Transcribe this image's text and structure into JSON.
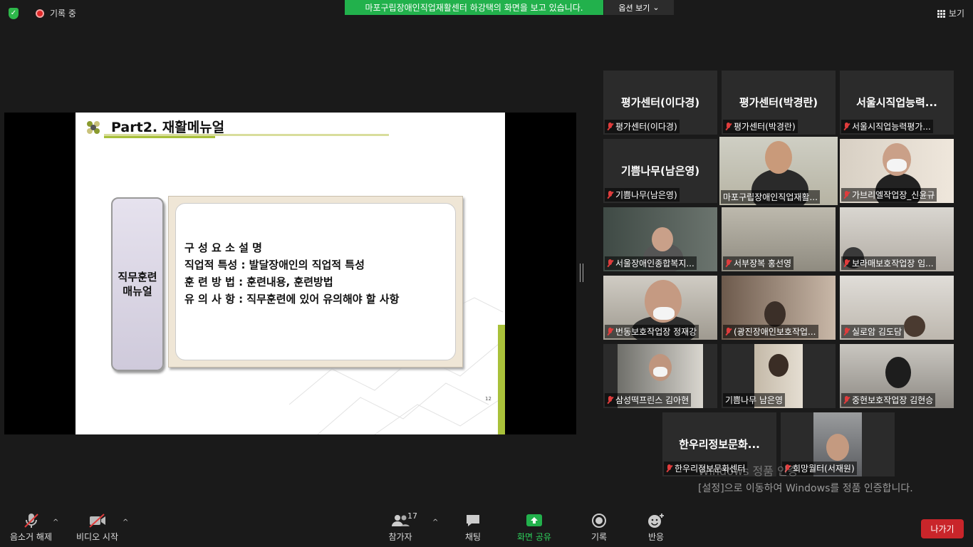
{
  "topbar": {
    "recording_label": "기록 중",
    "share_banner": "마포구립장애인직업재활센터 하강택의 화면을 보고 있습니다.",
    "view_options_label": "옵션 보기",
    "view_label": "보기"
  },
  "slide": {
    "title": "Part2. 재활메뉴얼",
    "side_label_line1": "직무훈련",
    "side_label_line2": "매뉴얼",
    "lines": [
      "구 성  요 소       설  명",
      "직업적 특성 : 발달장애인의 직업적 특성",
      "훈  련  방 법 : 훈련내용, 훈련방법",
      "유  의  사 항 : 직무훈련에 있어 유의해야 할 사항"
    ],
    "page_number": "12"
  },
  "participants": [
    {
      "display": "평가센터(이다경)",
      "label": "평가센터(이다경)"
    },
    {
      "display": "평가센터(박경란)",
      "label": "평가센터(박경란)"
    },
    {
      "display": "서울시직업능력...",
      "label": "서울시직업능력평가..."
    },
    {
      "display": "기쁨나무(남은영)",
      "label": "기쁨나무(남은영)"
    },
    {
      "display": "",
      "label": "마포구립장애인직업재활..."
    },
    {
      "display": "",
      "label": "가브리엘작업장_신윤규"
    },
    {
      "display": "",
      "label": "서울장애인종합복지..."
    },
    {
      "display": "",
      "label": "서부장복 홍선영"
    },
    {
      "display": "",
      "label": "보라매보호작업장 임..."
    },
    {
      "display": "",
      "label": "번동보호작업장 정재강"
    },
    {
      "display": "",
      "label": "(광진장애인보호작업..."
    },
    {
      "display": "",
      "label": "실로암 김도담"
    },
    {
      "display": "",
      "label": "삼성떡프린스 김아현"
    },
    {
      "display": "",
      "label": "기쁨나무 남은영"
    },
    {
      "display": "",
      "label": "중현보호작업장 김현승"
    },
    {
      "display": "한우리정보문화...",
      "label": "한우리정보문화센터"
    },
    {
      "display": "",
      "label": "희망월터(서재원)"
    }
  ],
  "watermark": {
    "line1": "Windows 정품 인증",
    "line2": "[설정]으로 이동하여 Windows를 정품 인증합니다."
  },
  "toolbar": {
    "unmute_label": "음소거 해제",
    "start_video_label": "비디오 시작",
    "participants_label": "참가자",
    "participants_count": "17",
    "chat_label": "채팅",
    "share_label": "화면 공유",
    "record_label": "기록",
    "reactions_label": "반응",
    "leave_label": "나가기"
  },
  "colors": {
    "share_green": "#22b14c",
    "leave_red": "#c9252a",
    "active_speaker": "#e8e05a"
  }
}
